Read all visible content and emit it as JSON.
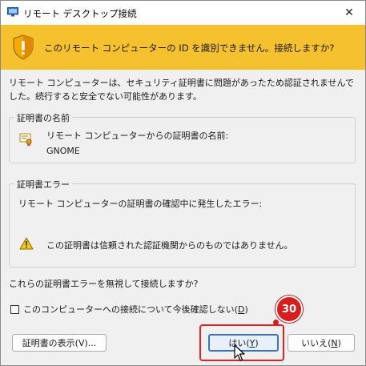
{
  "window": {
    "title": "リモート デスクトップ接続",
    "close_glyph": "✕"
  },
  "banner": {
    "message": "このリモート コンピューターの ID を識別できません。接続しますか?",
    "color": "#f6c12e"
  },
  "intro": {
    "text": "リモート コンピューターは、セキュリティ証明書に問題があったため認証されませんでした。続行すると安全でない可能性があります。"
  },
  "cert_name_group": {
    "legend": "証明書の名前",
    "label": "リモート コンピューターからの証明書の名前:",
    "value": "GNOME"
  },
  "cert_error_group": {
    "legend": "証明書エラー",
    "label": "リモート コンピューターの証明書の確認中に発生したエラー:",
    "message": "この証明書は信頼された認証機関からのものではありません。"
  },
  "question": "これらの証明書エラーを無視して接続しますか?",
  "dont_ask_checkbox": {
    "label": "このコンピューターへの接続について今後確認しない(",
    "mnemonic": "D",
    "label_end": ")",
    "checked": false
  },
  "buttons": {
    "view_cert": "証明書の表示(V)...",
    "yes": {
      "label": "はい(",
      "mnemonic": "Y",
      "end": ")"
    },
    "no": {
      "label": "いいえ(",
      "mnemonic": "N",
      "end": ")"
    }
  },
  "annotation": {
    "step": "30",
    "color": "#d61e1e"
  }
}
